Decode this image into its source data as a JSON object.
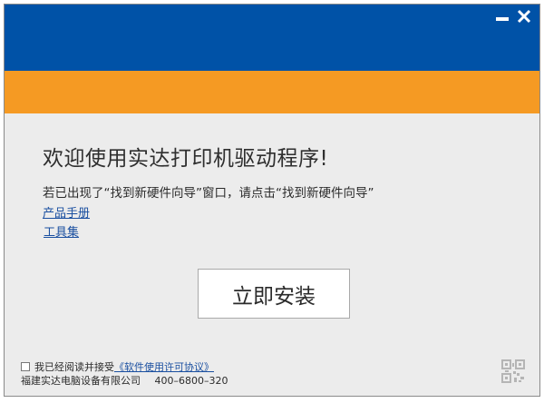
{
  "window": {
    "minimize_icon": "minimize-icon",
    "close_icon": "close-icon",
    "title_band_color": "#0052a7",
    "accent_band_color": "#f59a23"
  },
  "main": {
    "welcome": "欢迎使用实达打印机驱动程序!",
    "instruction": "若已出现了“找到新硬件向导”窗口，请点击“找到新硬件向导”",
    "links": {
      "manual": "产品手册",
      "tools": "工具集"
    },
    "install_button": "立即安装"
  },
  "footer": {
    "agree_text": "我已经阅读并接受",
    "license_link": "《软件使用许可协议》",
    "company": "福建实达电脑设备有限公司",
    "phone": "400–6800–320",
    "qr_icon": "qr-code-icon"
  }
}
